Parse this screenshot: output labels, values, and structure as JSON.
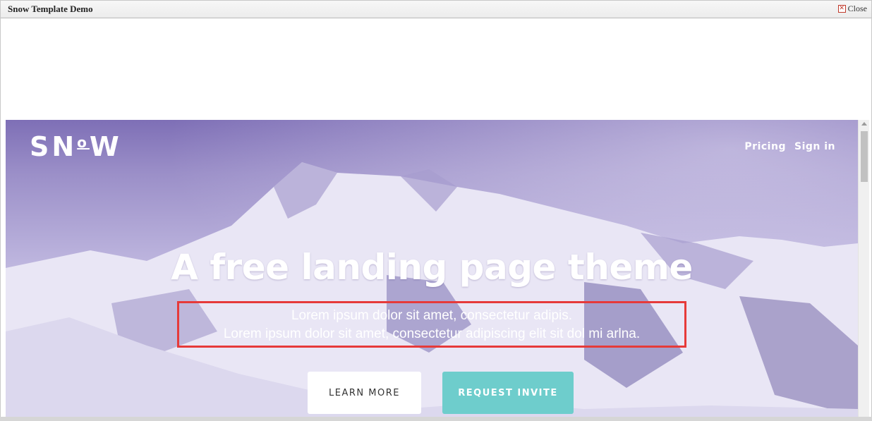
{
  "window": {
    "title": "Snow Template Demo",
    "close_label": "Close"
  },
  "site": {
    "logo": {
      "part1": "SN",
      "part2": "o",
      "part3": "W"
    },
    "nav": [
      {
        "label": "Pricing"
      },
      {
        "label": "Sign in"
      }
    ],
    "headline": "A free landing page theme",
    "subtext": {
      "line1": "Lorem ipsum dolor sit amet, consectetur adipis.",
      "line2": "Lorem ipsum dolor sit amet, consectetur adipiscing elit sit dol mi arlna."
    },
    "buttons": {
      "learn_more": "LEARN MORE",
      "request_invite": "REQUEST INVITE"
    }
  },
  "colors": {
    "hero_overlay": "#8b7fc2",
    "accent_button": "#6ecdcc",
    "highlight_box": "#e63a3a"
  }
}
